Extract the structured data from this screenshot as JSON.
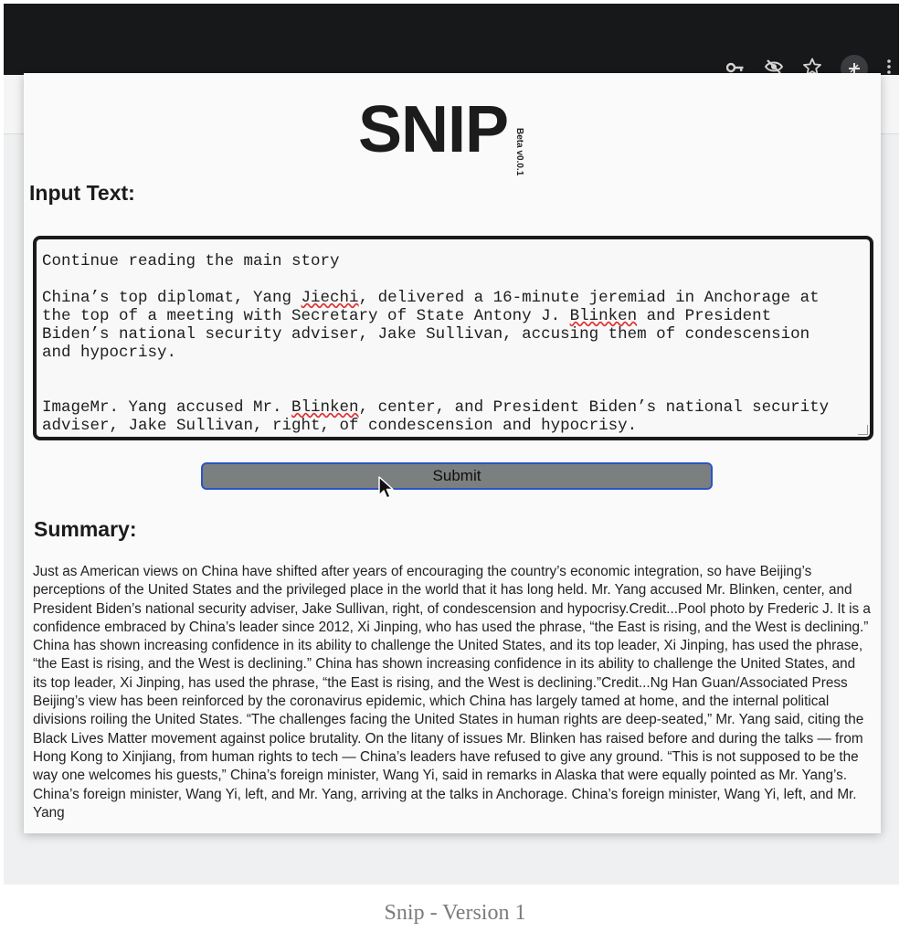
{
  "browser": {
    "toolbar_icons": [
      "key-icon",
      "eye-off-icon",
      "star-icon",
      "extension-icon",
      "more-icon"
    ]
  },
  "app": {
    "logo": "SNIP",
    "version_badge": "Beta v0.0.1"
  },
  "input": {
    "title": "Input Text:",
    "line_1": "Continue reading the main story",
    "p1_a": "China’s top diplomat, Yang ",
    "p1_jiechi": "Jiechi",
    "p1_b": ", delivered a 16-minute jeremiad in Anchorage at\nthe top of a meeting with Secretary of State Antony J. ",
    "p1_blinken": "Blinken",
    "p1_c": " and President\nBiden’s national security adviser, Jake Sullivan, accusing them of condescension\nand hypocrisy.",
    "p2_a": "ImageMr. Yang accused Mr. ",
    "p2_blinken": "Blinken",
    "p2_b": ", center, and President Biden’s national security\nadviser, Jake Sullivan, right, of condescension and hypocrisy."
  },
  "actions": {
    "submit_label": "Submit"
  },
  "summary": {
    "title": "Summary:",
    "text": "Just as American views on China have shifted after years of encouraging the country’s economic integration, so have Beijing’s perceptions of the United States and the privileged place in the world that it has long held. Mr. Yang accused Mr. Blinken, center, and President Biden’s national security adviser, Jake Sullivan, right, of condescension and hypocrisy.Credit...Pool photo by Frederic J. It is a confidence embraced by China’s leader since 2012, Xi Jinping, who has used the phrase, “the East is rising, and the West is declining.” China has shown increasing confidence in its ability to challenge the United States, and its top leader, Xi Jinping, has used the phrase, “the East is rising, and the West is declining.” China has shown increasing confidence in its ability to challenge the United States, and its top leader, Xi Jinping, has used the phrase, “the East is rising, and the West is declining.”Credit...Ng Han Guan/Associated Press Beijing’s view has been reinforced by the coronavirus epidemic, which China has largely tamed at home, and the internal political divisions roiling the United States. “The challenges facing the United States in human rights are deep-seated,” Mr. Yang said, citing the Black Lives Matter movement against police brutality. On the litany of issues Mr. Blinken has raised before and during the talks — from Hong Kong to Xinjiang, from human rights to tech — China’s leaders have refused to give any ground. “This is not supposed to be the way one welcomes his guests,” China’s foreign minister, Wang Yi, said in remarks in Alaska that were equally pointed as Mr. Yang’s. China’s foreign minister, Wang Yi, left, and Mr. Yang, arriving at the talks in Anchorage. China’s foreign minister, Wang Yi, left, and Mr. Yang"
  },
  "caption": "Snip - Version 1"
}
